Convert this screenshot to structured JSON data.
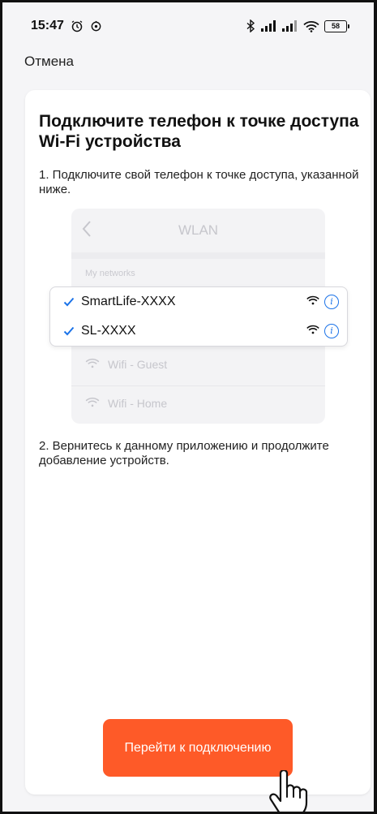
{
  "status_bar": {
    "time": "15:47",
    "battery": "58",
    "icons": [
      "alarm-icon",
      "sync-icon",
      "bluetooth-icon",
      "signal-icon",
      "signal-icon",
      "wifi-icon",
      "battery-icon"
    ]
  },
  "header": {
    "cancel_label": "Отмена"
  },
  "card": {
    "title": "Подключите телефон к точке доступа Wi-Fi устройства",
    "step1": "1. Подключите свой телефон к точке доступа, указанной ниже.",
    "step2": "2. Вернитесь к данному приложению и продолжите добавление устройств."
  },
  "illustration": {
    "title": "WLAN",
    "section_label": "My networks",
    "selected_networks": [
      {
        "name": "SmartLife-XXXX"
      },
      {
        "name": "SL-XXXX"
      }
    ],
    "other_networks": [
      {
        "name": "Wifi - Guest"
      },
      {
        "name": "Wifi - Home"
      }
    ]
  },
  "cta": {
    "label": "Перейти к подключению"
  },
  "colors": {
    "accent": "#fe5a28",
    "link_blue": "#1b73e8",
    "background": "#f5f5f7"
  }
}
